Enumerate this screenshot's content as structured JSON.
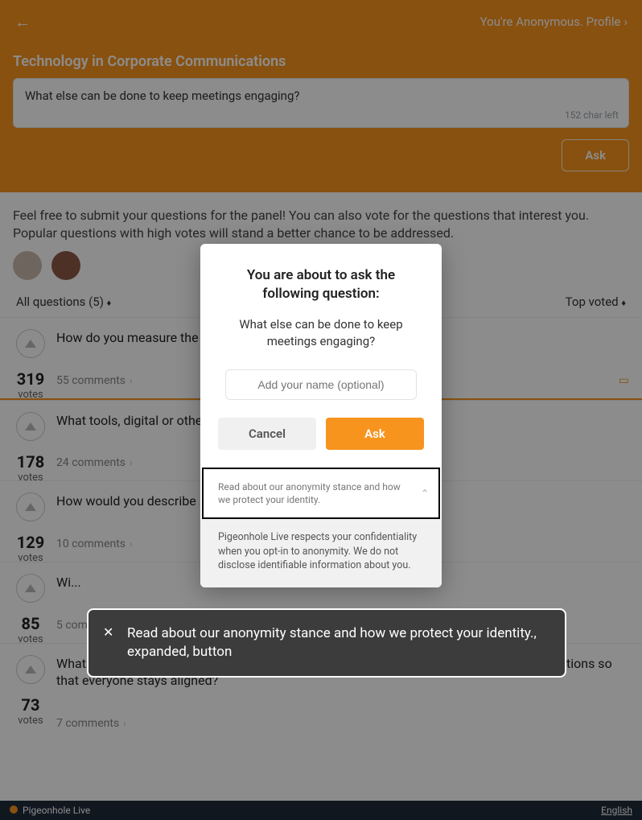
{
  "header": {
    "profile_text": "You're Anonymous. Profile"
  },
  "hero": {
    "title": "Technology in Corporate Communications",
    "input_value": "What else can be done to keep meetings engaging?",
    "char_left": "152 char left",
    "ask_label": "Ask"
  },
  "intro": "Feel free to submit your questions for the panel! You can also vote for the questions that interest you. Popular questions with high votes will stand a better chance to be addressed.",
  "filter": {
    "all_label": "All questions (5)",
    "sort_label": "Top voted"
  },
  "questions": [
    {
      "text": "How do you measure the ...",
      "votes": "319",
      "votes_label": "votes",
      "comments": "55 comments",
      "presenting": true
    },
    {
      "text": "What tools, digital or otherwise ... communications?",
      "votes": "178",
      "votes_label": "votes",
      "comments": "24 comments",
      "presenting": false
    },
    {
      "text": "How would you describe ...",
      "votes": "129",
      "votes_label": "votes",
      "comments": "10 comments",
      "presenting": false
    },
    {
      "text": "Wi...",
      "votes": "85",
      "votes_label": "votes",
      "comments": "5 comments",
      "presenting": false
    },
    {
      "text": "What is the reporting structure like in your organisation? How do you manage communications so that everyone stays aligned?",
      "votes": "73",
      "votes_label": "votes",
      "comments": "7 comments",
      "presenting": false
    }
  ],
  "modal": {
    "title": "You are about to ask the following question:",
    "question": "What else can be done to keep meetings engaging?",
    "name_placeholder": "Add your name (optional)",
    "cancel_label": "Cancel",
    "ask_label": "Ask",
    "anon_toggle_text": "Read about our anonymity stance and how we protect your identity.",
    "anon_body_text": "Pigeonhole Live respects your confidentiality when you opt-in to anonymity. We do not disclose identifiable information about you."
  },
  "toast": {
    "text": "Read about our anonymity stance and how we protect your identity., expanded, button"
  },
  "footer": {
    "brand": "Pigeonhole Live",
    "language": "English"
  }
}
